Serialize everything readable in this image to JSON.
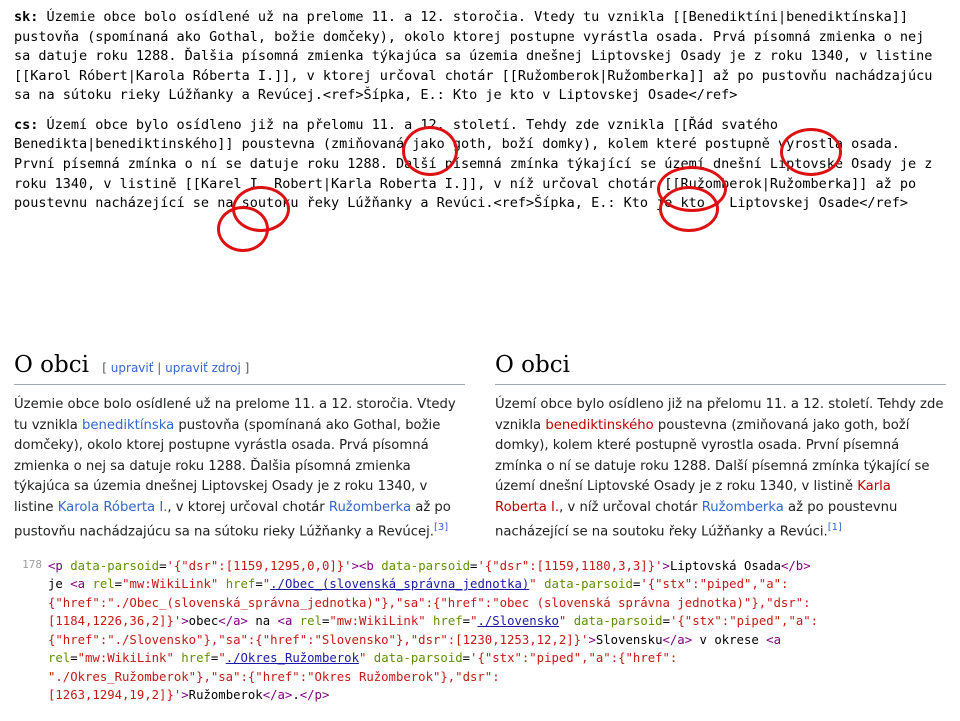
{
  "sk": {
    "prefix": "sk:",
    "text": " Územie obce bolo osídlené už na prelome 11. a 12. storočia. Vtedy tu vznikla [[Benediktíni|benediktínska]] pustovňa (spomínaná ako Gothal, božie domčeky), okolo ktorej postupne vyrástla osada. Prvá písomná zmienka o nej sa datuje roku 1288. Ďalšia písomná zmienka týkajúca sa územia dnešnej Liptovskej Osady je z roku 1340, v listine [[Karol Róbert|Karola Róberta I.]], v ktorej určoval chotár [[Ružomberok|Ružomberka]] až po pustovňu nachádzajúcu sa na sútoku rieky Lúžňanky a Revúcej.<ref>Šípka, E.: Kto je kto v Liptovskej Osade</ref>"
  },
  "cs": {
    "prefix": "cs:",
    "text": " Území obce bylo osídleno již na přelomu 11. a 12. století. Tehdy zde vznikla [[Řád svatého Benedikta|benediktinského]] poustevna (zmiňovaná jako goth, boží domky), kolem které postupně vyrostla osada. První písemná zmínka o ní se datuje roku 1288. Další písemná zmínka týkající se území dnešní Liptovské Osady je z roku 1340, v listině [[Karel I. Robert|Karla Roberta I.]], v níž určoval chotár [[Ružomberok|Ružomberka]] až po poustevnu nacházející se na soutoku řeky Lúžňanky a Revúci.<ref>Šípka, E.: Kto je kto v Liptovskej Osade</ref>"
  },
  "rendered": {
    "left": {
      "heading": "O obci",
      "edit1": "upraviť",
      "edit2": "upraviť zdroj",
      "body_pre": "Územie obce bolo osídlené už na prelome 11. a 12. storočia. Vtedy tu vznikla ",
      "link1": "benediktínska",
      "body_mid1": " pustovňa (spomínaná ako Gothal, božie domčeky), okolo ktorej postupne vyrástla osada. Prvá písomná zmienka o nej sa datuje roku 1288. Ďalšia písomná zmienka týkajúca sa územia dnešnej Liptovskej Osady je z roku 1340, v listine ",
      "link2": "Karola Róberta I.",
      "body_mid2": ", v ktorej určoval chotár ",
      "link3": "Ružomberka",
      "body_end": " až po pustovňu nachádzajúcu sa na sútoku rieky Lúžňanky a Revúcej.",
      "ref": "[3]"
    },
    "right": {
      "heading": "O obci",
      "body_pre": "Území obce bylo osídleno již na přelomu 11. a 12. století. Tehdy zde vznikla ",
      "link1": "benediktinského",
      "body_mid1": " poustevna (zmiňovaná jako goth, boží domky), kolem které postupně vyrostla osada. První písemná zmínka o ní se datuje roku 1288. Další písemná zmínka týkající se území dnešní Liptovské Osady je z roku 1340, v listině ",
      "link2": "Karla Roberta I.",
      "body_mid2": ", v níž určoval chotár ",
      "link3": "Ružomberka",
      "body_end": " až po poustevnu nacházející se na soutoku řeky Lúžňanky a Revúci.",
      "ref": "[1]"
    }
  },
  "src": {
    "lineno": "178",
    "line1_a": "<p data-parsoid='{\"dsr\":[1159,1295,0,0]}'><b data-parsoid='{\"dsr\":[1159,1180,3,3]}'>Liptovská Osada</b>",
    "line2_a": "je ",
    "line2_b": "<a rel=\"mw:WikiLink\" href=\"./Obec_(slovenská_správna_jednotka)\" data-parsoid='{\"stx\":\"piped\",\"a\":",
    "line3_a": "{\"href\":\"./Obec_(slovenská_správna_jednotka)\"},\"sa\":{\"href\":\"obec (slovenská správna jednotka)\"},\"dsr\":",
    "line4_a": "[1184,1226,36,2]}'>obec</a> na <a rel=\"mw:WikiLink\" href=\"./Slovensko\" data-parsoid='{\"stx\":\"piped\",\"a\":",
    "line5_a": "{\"href\":\"./Slovensko\"},\"sa\":{\"href\":\"Slovensko\"},\"dsr\":[1230,1253,12,2]}'>Slovensku</a> v okrese <a",
    "line6_a": "rel=\"mw:WikiLink\" href=\"./Okres_Ružomberok\" data-parsoid='{\"stx\":\"piped\",\"a\":{\"href\":",
    "line7_a": "\"./Okres_Ružomberok\"},\"sa\":{\"href\":\"Okres Ružomberok\"},\"dsr\":",
    "line8_a": "[1263,1294,19,2]}'>Ružomberok</a>.</p>"
  }
}
